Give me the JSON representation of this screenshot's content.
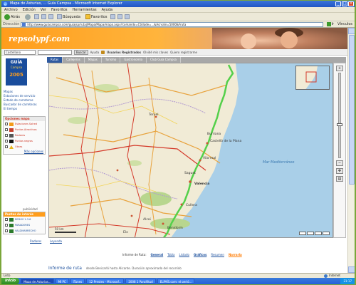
{
  "window": {
    "title": "Mapa de Asturias, ... Guía Campsa - Microsoft Internet Explorer"
  },
  "menu": [
    "Archivo",
    "Edición",
    "Ver",
    "Favoritos",
    "Herramientas",
    "Ayuda"
  ],
  "toolbar": {
    "back": "Atrás",
    "search": "Búsqueda",
    "favorites": "Favoritos"
  },
  "address": {
    "label": "Dirección",
    "url": "http://www.guiacampsa.com/guiajsp/rutaj/Mapa/Mapa/mapa.aspx?comando=Ctidade=...&Acrvaln=5000&Fruta",
    "go": "Ir",
    "links": "Vínculos"
  },
  "site": {
    "logo": "repsolypf.com"
  },
  "strip": {
    "select_value": "Castellano",
    "search_btn": "Buscar",
    "in_label": "Ayuda",
    "users": "Usuarios Registrados",
    "forgot": "Olvidé mis claves",
    "register": "Quiero registrarme"
  },
  "guia": {
    "line1": "GUÍA",
    "line2": "Campsa",
    "year": "2005"
  },
  "navlinks": [
    "Mapas",
    "Estaciones de servicio",
    "Estado de carreteras",
    "Buscador de carreteras",
    "El tiempo"
  ],
  "map_options": {
    "title": "Opciones mapa",
    "items": [
      {
        "label": "Estaciones Solred"
      },
      {
        "label": "Puntos Atractivos"
      },
      {
        "label": "Radares"
      },
      {
        "label": "Puntos negros"
      },
      {
        "label": "Obras"
      }
    ],
    "more": "Más opciones"
  },
  "publicidad": "publicidad",
  "poi": {
    "title": "Puntos de interés",
    "items": [
      {
        "label": "REDGS 1.3.6"
      },
      {
        "label": "PARADORES"
      },
      {
        "label": "VALDMARRECHO"
      }
    ]
  },
  "radares_link": "Radares",
  "tabs": [
    "Rutas",
    "Callejeros",
    "Mapas",
    "Turismo",
    "Gastronomía",
    "Club Guía Campsa"
  ],
  "map": {
    "place_labels": [
      "Valencia",
      "Sagunt",
      "Castelló de la Plana",
      "Vila-real",
      "Burriana",
      "Teruel",
      "Alcoi",
      "Benidorm",
      "Elx",
      "Cullera"
    ],
    "sea_label": "Mar Mediterráneo",
    "scale": "50 km"
  },
  "leyenda": "Leyenda",
  "route": {
    "label": "Informe de Ruta:",
    "general": "General",
    "tabla": "Tabla",
    "listado": "Listado",
    "graficos": "Gráficos",
    "resumen": "Resumen",
    "narrar": "Narrarla"
  },
  "informe": {
    "title": "Informe de ruta",
    "note": "desde Benicarló hasta Alicante. Duración aproximada del recorrido"
  },
  "status": {
    "left": "Listo",
    "zone": "Internet"
  },
  "taskbar": {
    "start": "inicio",
    "tasks": [
      "Mapa de Asturias...",
      "MI PC",
      "iTunes",
      "12 Prestes - Microsof...",
      "2008 1 Paralfitud",
      "ELPAÍS.com: el perió..."
    ],
    "clock": "21:17"
  }
}
